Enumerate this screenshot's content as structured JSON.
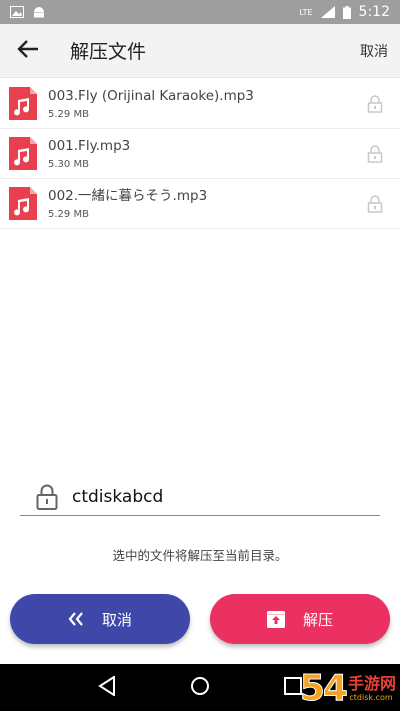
{
  "status_bar": {
    "time": "5:12",
    "network_label": "LTE",
    "icons": [
      "image-icon",
      "android-icon",
      "signal-icon",
      "battery-icon"
    ]
  },
  "app_bar": {
    "title": "解压文件",
    "cancel_label": "取消",
    "back_icon": "arrow-left-icon"
  },
  "files": [
    {
      "name": "003.Fly (Orijinal Karaoke).mp3",
      "size": "5.29 MB",
      "type_label": "mp3"
    },
    {
      "name": "001.Fly.mp3",
      "size": "5.30 MB",
      "type_label": "mp3"
    },
    {
      "name": "002.一緒に暮らそう.mp3",
      "size": "5.29 MB",
      "type_label": "mp3"
    }
  ],
  "password": {
    "value": "ctdiskabcd"
  },
  "hint": "选中的文件将解压至当前目录。",
  "buttons": {
    "cancel_label": "取消",
    "extract_label": "解压"
  },
  "colors": {
    "cancel_button": "#3f48a8",
    "extract_button": "#ea3162",
    "file_icon": "#e8404f"
  },
  "watermark": {
    "number": "54",
    "text": "手游网",
    "sub": "ctdisk.com"
  }
}
